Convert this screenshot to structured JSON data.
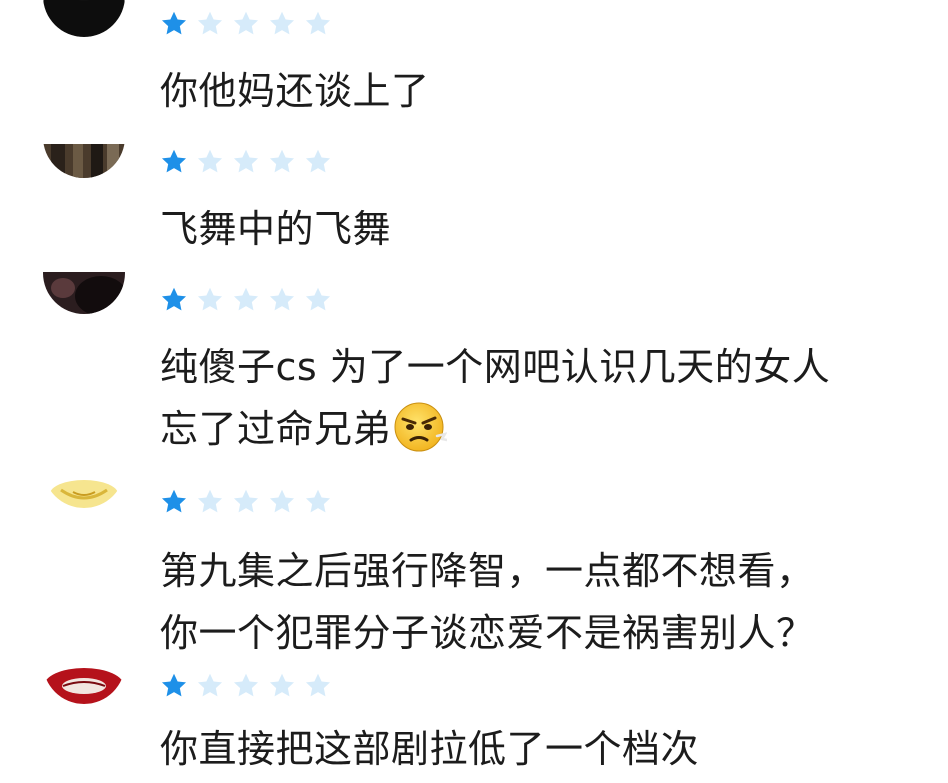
{
  "reviews": [
    {
      "rating": 1,
      "max_rating": 5,
      "avatar": "dark-silhouette-avatar",
      "lines": [
        "你他妈还谈上了"
      ]
    },
    {
      "rating": 1,
      "max_rating": 5,
      "avatar": "photo-avatar",
      "lines": [
        "飞舞中的飞舞"
      ]
    },
    {
      "rating": 1,
      "max_rating": 5,
      "avatar": "dark-photo-avatar",
      "lines": [
        "纯傻子cs 为了一个网吧认识几天的女人",
        "忘了过命兄弟"
      ],
      "emoji": "angry-face-emoji"
    },
    {
      "rating": 1,
      "max_rating": 5,
      "avatar": "yellow-avatar",
      "lines": [
        "第九集之后强行降智，一点都不想看，",
        "你一个犯罪分子谈恋爱不是祸害别人？"
      ]
    },
    {
      "rating": 1,
      "max_rating": 5,
      "avatar": "red-lips-avatar",
      "lines": [
        "你直接把这部剧拉低了一个档次"
      ]
    }
  ],
  "colors": {
    "star_filled": "#1e90e8",
    "star_empty": "#d6ebfa",
    "text": "#1c1c1c"
  }
}
